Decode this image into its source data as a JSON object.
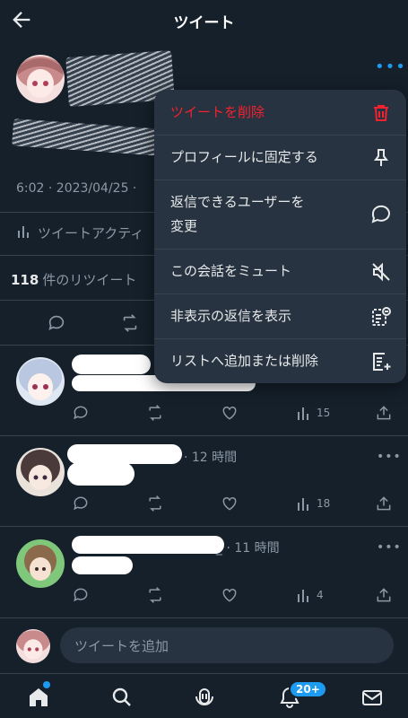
{
  "header": {
    "title": "ツイート"
  },
  "tweet": {
    "meta": "6:02 · 2023/04/25 ·",
    "activity_label": "ツイートアクティ",
    "retweets_count": "118",
    "retweets_label": "件のリツイート"
  },
  "menu": {
    "items": [
      {
        "label": "ツイートを削除",
        "icon": "trash-icon",
        "danger": true
      },
      {
        "label": "プロフィールに固定する",
        "icon": "pin-icon"
      },
      {
        "label": "返信できるユーザーを\n変更",
        "icon": "speech-bubble-icon"
      },
      {
        "label": "この会話をミュート",
        "icon": "mute-icon"
      },
      {
        "label": "非表示の返信を表示",
        "icon": "hidden-replies-icon"
      },
      {
        "label": "リストへ追加または削除",
        "icon": "list-add-icon"
      }
    ]
  },
  "replies": [
    {
      "time": "",
      "views": "15"
    },
    {
      "time": "· 12 時間",
      "views": "18"
    },
    {
      "time": "_ · 11 時間",
      "views": "4"
    }
  ],
  "reply_bar": {
    "placeholder": "ツイートを追加"
  },
  "bottom_nav": {
    "notifications_badge": "20+"
  },
  "colors": {
    "background": "#15202b",
    "accent": "#1d9bf0",
    "danger": "#f4212e",
    "menu_bg": "#273340"
  }
}
